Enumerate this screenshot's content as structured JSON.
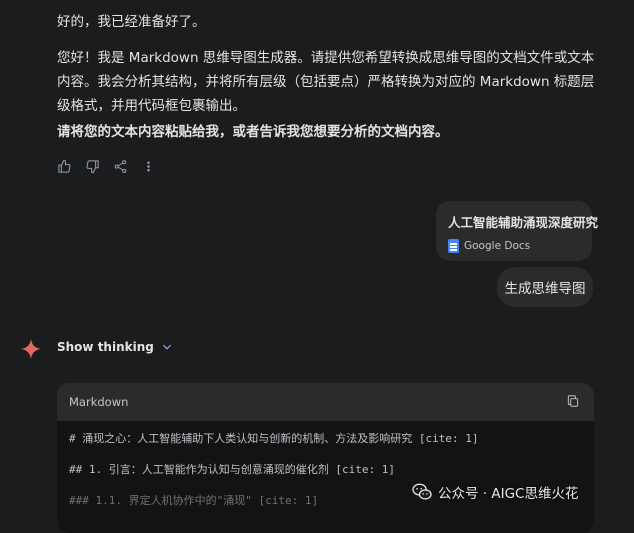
{
  "assistant_reply": {
    "p1": "好的，我已经准备好了。",
    "p2": "您好！我是 Markdown 思维导图生成器。请提供您希望转换成思维导图的文档文件或文本内容。我会分析其结构，并将所有层级（包括要点）严格转换为对应的 Markdown 标题层级格式，并用代码框包裹输出。",
    "p3": "请将您的文本内容粘贴给我，或者告诉我您想要分析的文档内容。"
  },
  "actions": {
    "icons": [
      "thumb-up-icon",
      "thumb-down-icon",
      "share-icon",
      "more-vert-icon"
    ]
  },
  "user_attachment": {
    "title": "人工智能辅助涌现深度研究",
    "source": "Google Docs"
  },
  "user_message": "生成思维导图",
  "thinking": {
    "label": "Show thinking"
  },
  "code_block": {
    "language": "Markdown",
    "lines": [
      "# 涌现之心：人工智能辅助下人类认知与创新的机制、方法及影响研究 [cite: 1]",
      "## 1. 引言：人工智能作为认知与创意涌现的催化剂 [cite: 1]",
      "### 1.1. 界定人机协作中的\"涌现\" [cite: 1]"
    ]
  },
  "watermark": {
    "text": "公众号 · AIGC思维火花"
  },
  "colors": {
    "background": "#1b1c1d",
    "bubble": "#2a2b2d",
    "accent_blue": "#8ab4f8",
    "gemini_red": "#e46962",
    "docs_blue": "#4285f4"
  }
}
